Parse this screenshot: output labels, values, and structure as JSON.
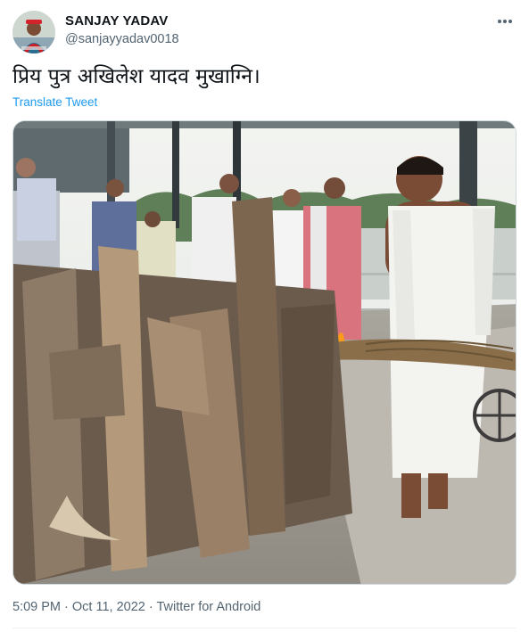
{
  "author": {
    "name": "SANJAY YADAV",
    "handle": "@sanjayyadav0018",
    "avatar_icon": "user-avatar-icon"
  },
  "menu": {
    "more_icon": "more-options-icon"
  },
  "tweet": {
    "text": "प्रिय पुत्र अखिलेश यादव मुखाग्नि।",
    "translate_label": "Translate Tweet"
  },
  "media": {
    "icon": "photo-icon"
  },
  "meta": {
    "time": "5:09 PM",
    "separator1": " · ",
    "date": "Oct 11, 2022",
    "separator2": " · ",
    "source": "Twitter for Android"
  },
  "colors": {
    "accent": "#1d9bf0",
    "text_primary": "#0f1419",
    "text_secondary": "#536471",
    "border": "#cfd9de"
  }
}
